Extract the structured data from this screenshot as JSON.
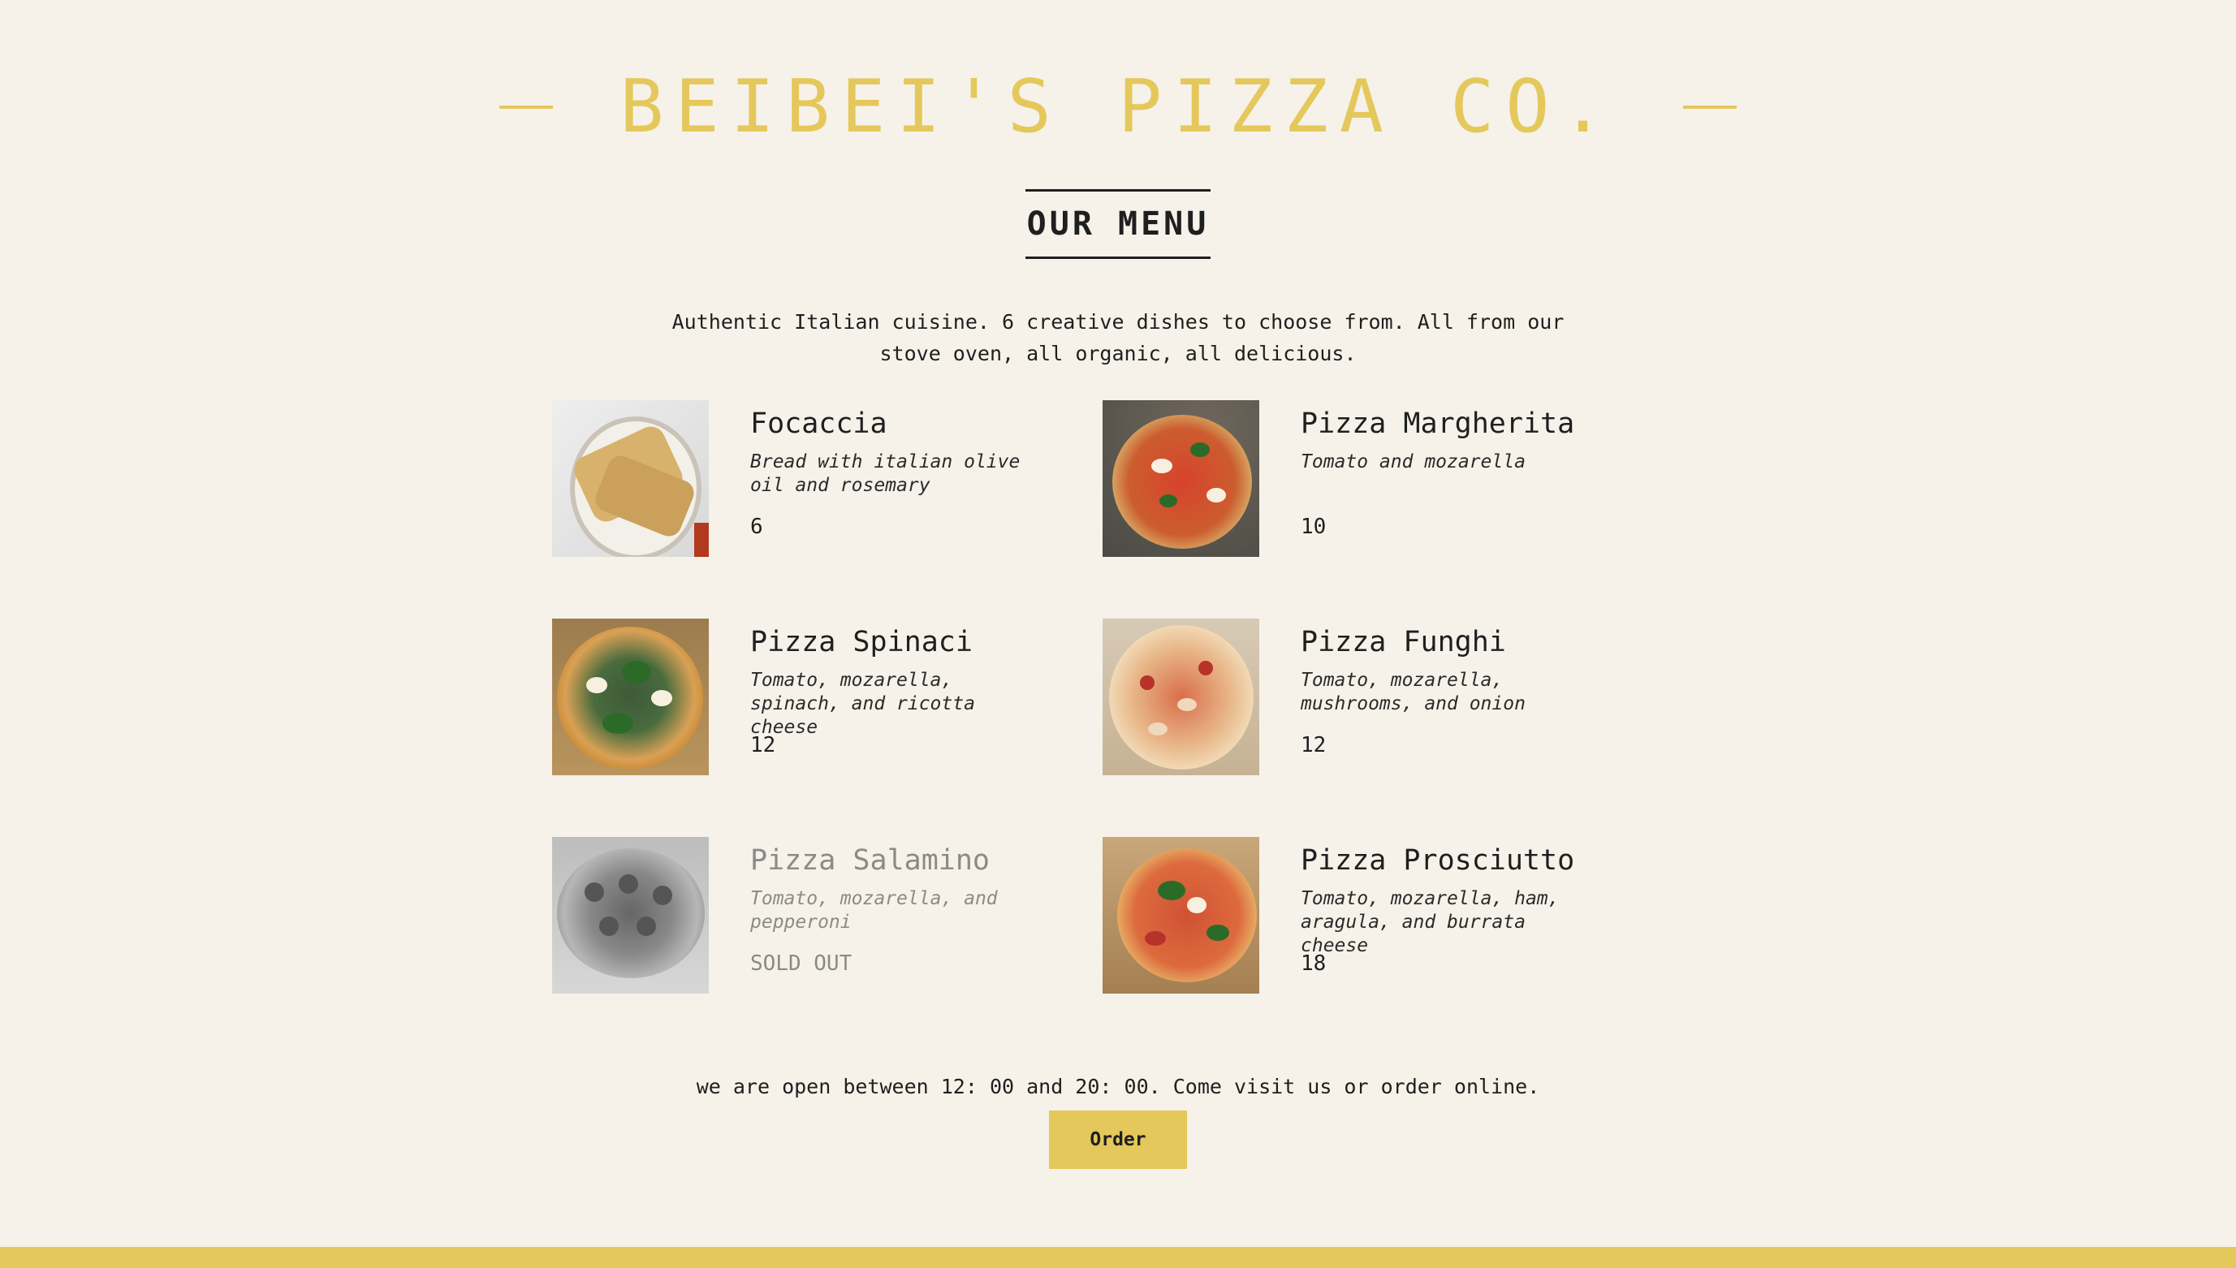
{
  "header": {
    "title": "BEIBEI'S PIZZA CO."
  },
  "menu": {
    "title": "OUR MENU",
    "intro": "Authentic Italian cuisine. 6 creative dishes to choose from. All from our stove oven, all organic, all delicious.",
    "items": [
      {
        "name": "Focaccia",
        "description": "Bread with italian olive oil and rosemary",
        "price": "6",
        "image_icon": "focaccia-image"
      },
      {
        "name": "Pizza Margherita",
        "description": "Tomato and mozarella",
        "price": "10",
        "image_icon": "pizza-margherita-image"
      },
      {
        "name": "Pizza Spinaci",
        "description": "Tomato, mozarella, spinach, and ricotta cheese",
        "price": "12",
        "image_icon": "pizza-spinaci-image"
      },
      {
        "name": "Pizza Funghi",
        "description": "Tomato, mozarella, mushrooms, and onion",
        "price": "12",
        "image_icon": "pizza-funghi-image"
      },
      {
        "name": "Pizza Salamino",
        "description": "Tomato, mozarella, and pepperoni",
        "price": "SOLD OUT",
        "image_icon": "pizza-salamino-image"
      },
      {
        "name": "Pizza Prosciutto",
        "description": "Tomato, mozarella, ham, aragula, and burrata cheese",
        "price": "18",
        "image_icon": "pizza-prosciutto-image"
      }
    ]
  },
  "footer": {
    "hours": "we are open between 12: 00 and 20: 00. Come visit us or order online.",
    "order_label": "Order"
  },
  "colors": {
    "background": "#f6f2ea",
    "accent": "#e5c85c",
    "text": "#1f1f1f",
    "sold_out": "#8b8a86"
  }
}
